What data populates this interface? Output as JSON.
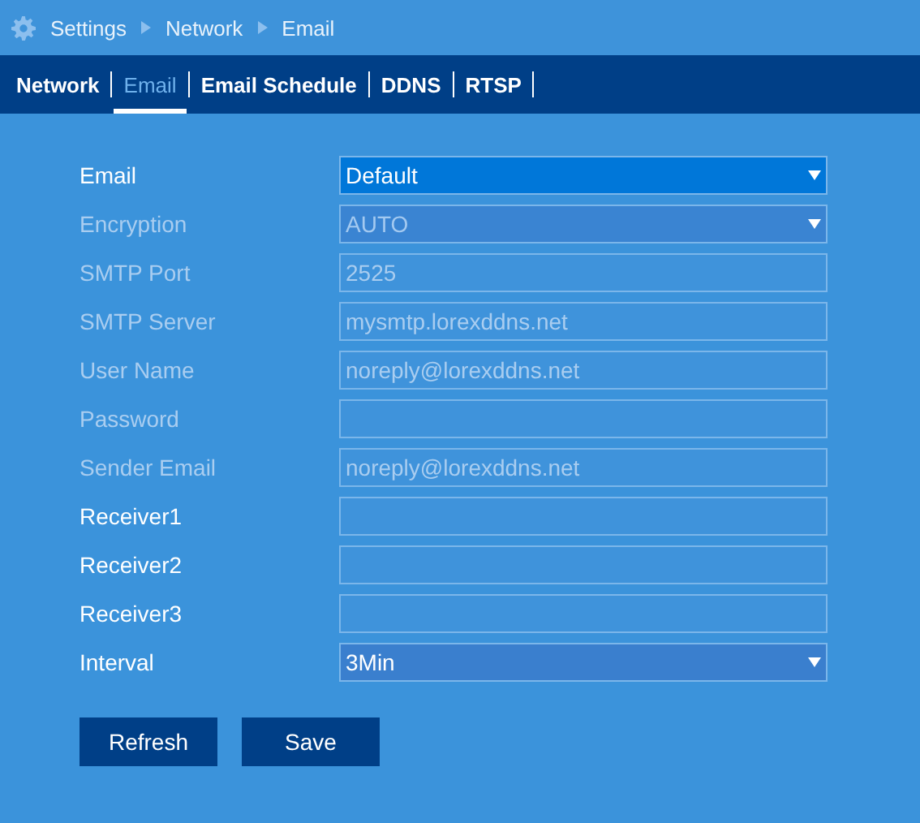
{
  "breadcrumb": [
    "Settings",
    "Network",
    "Email"
  ],
  "tabs": [
    {
      "label": "Network",
      "selected": false
    },
    {
      "label": "Email",
      "selected": true
    },
    {
      "label": "Email Schedule",
      "selected": false
    },
    {
      "label": "DDNS",
      "selected": false
    },
    {
      "label": "RTSP",
      "selected": false
    }
  ],
  "fields": [
    {
      "label": "Email",
      "kind": "select",
      "value": "Default",
      "disabled": false,
      "highlighted": true
    },
    {
      "label": "Encryption",
      "kind": "select",
      "value": "AUTO",
      "disabled": true,
      "highlighted": false
    },
    {
      "label": "SMTP Port",
      "kind": "text",
      "value": "2525",
      "disabled": true,
      "highlighted": false
    },
    {
      "label": "SMTP Server",
      "kind": "text",
      "value": "mysmtp.lorexddns.net",
      "disabled": true,
      "highlighted": false
    },
    {
      "label": "User Name",
      "kind": "text",
      "value": "noreply@lorexddns.net",
      "disabled": true,
      "highlighted": false
    },
    {
      "label": "Password",
      "kind": "text",
      "disabled": true,
      "highlighted": false
    },
    {
      "label": "Sender Email",
      "kind": "text",
      "value": "noreply@lorexddns.net",
      "disabled": true,
      "highlighted": false
    },
    {
      "label": "Receiver1",
      "kind": "text",
      "disabled": false,
      "highlighted": false
    },
    {
      "label": "Receiver2",
      "kind": "text",
      "disabled": false,
      "highlighted": false
    },
    {
      "label": "Receiver3",
      "kind": "text",
      "disabled": false,
      "highlighted": false
    },
    {
      "label": "Interval",
      "kind": "select",
      "value": "3Min",
      "disabled": false,
      "highlighted": false
    }
  ],
  "buttons": [
    "Refresh",
    "Save"
  ]
}
